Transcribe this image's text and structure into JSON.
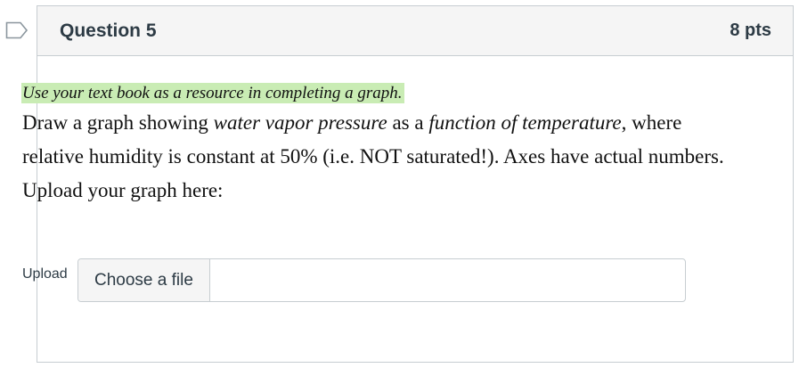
{
  "question": {
    "title": "Question 5",
    "points": "8 pts",
    "hint": "Use your text book as a resource in completing a graph.",
    "prompt": {
      "part1": "Draw a graph showing ",
      "em1": "water vapor pressure",
      "part2": " as a ",
      "em2": "function of temperature",
      "part3": ", where relative humidity is constant at 50% (i.e. NOT saturated!). Axes have actual numbers. Upload your graph here:"
    }
  },
  "upload": {
    "label": "Upload",
    "button_label": "Choose a file",
    "file_name": ""
  },
  "colors": {
    "hint_highlight": "#c9ecb4",
    "header_background": "#f5f5f5",
    "border": "#c7cdd1"
  },
  "icons": {
    "flag": "flag-outline-icon"
  }
}
